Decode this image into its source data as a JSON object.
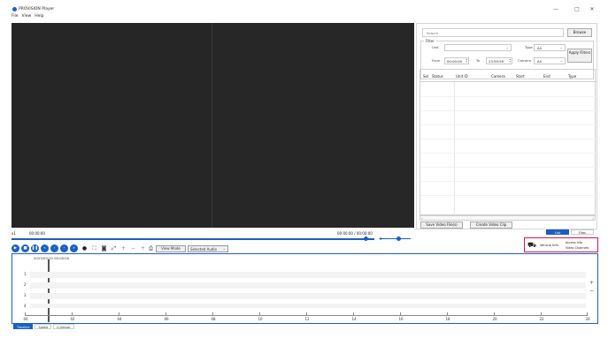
{
  "window": {
    "title": "PROVISION Player",
    "minimize": "—",
    "maximize": "□",
    "close": "✕"
  },
  "menu": [
    "File",
    "View",
    "Help"
  ],
  "panel": {
    "search_placeholder": "Search",
    "browse_label": "Browse",
    "filter": {
      "legend": "Filter",
      "unit_label": "Unit",
      "unit_value": "",
      "type_label": "Type",
      "type_value": "All",
      "from_label": "From",
      "from_value": "00:00:00",
      "to_label": "To",
      "to_value": "23:59:59",
      "camera_label": "Camera",
      "camera_value": "All",
      "apply_label": "Apply Filters"
    },
    "table_headers": [
      "Sel",
      "Status",
      "Unit ID",
      "Camera",
      "Start",
      "End",
      "Type"
    ],
    "save_label": "Save Video File(s)",
    "create_label": "Create Video Clip"
  },
  "status": {
    "left_id": "x1",
    "left_time": "00:00:00",
    "center_time": "00:00:00 / 00:00:00"
  },
  "toolbar": {
    "view_mode_label": "View Mode",
    "audio_label": "Selected Audio"
  },
  "right_tabs": [
    "List",
    "Files"
  ],
  "alarm": {
    "label": "Vehicle Info",
    "line1": "Access Info",
    "line2": "Video Channels"
  },
  "timeline": {
    "date": "2023/03/10 00:00:00",
    "lanes": [
      "1",
      "2",
      "3",
      "4"
    ],
    "ticks": [
      "00",
      "02",
      "04",
      "06",
      "08",
      "10",
      "12",
      "14",
      "16",
      "18",
      "20",
      "22",
      "24"
    ]
  },
  "bottom_tabs": [
    "Timeline",
    "Speed",
    "G-Sensor"
  ],
  "colors": {
    "accent": "#1a5fc4",
    "video_bg": "#262626",
    "alarm_border": "#dd1144"
  }
}
